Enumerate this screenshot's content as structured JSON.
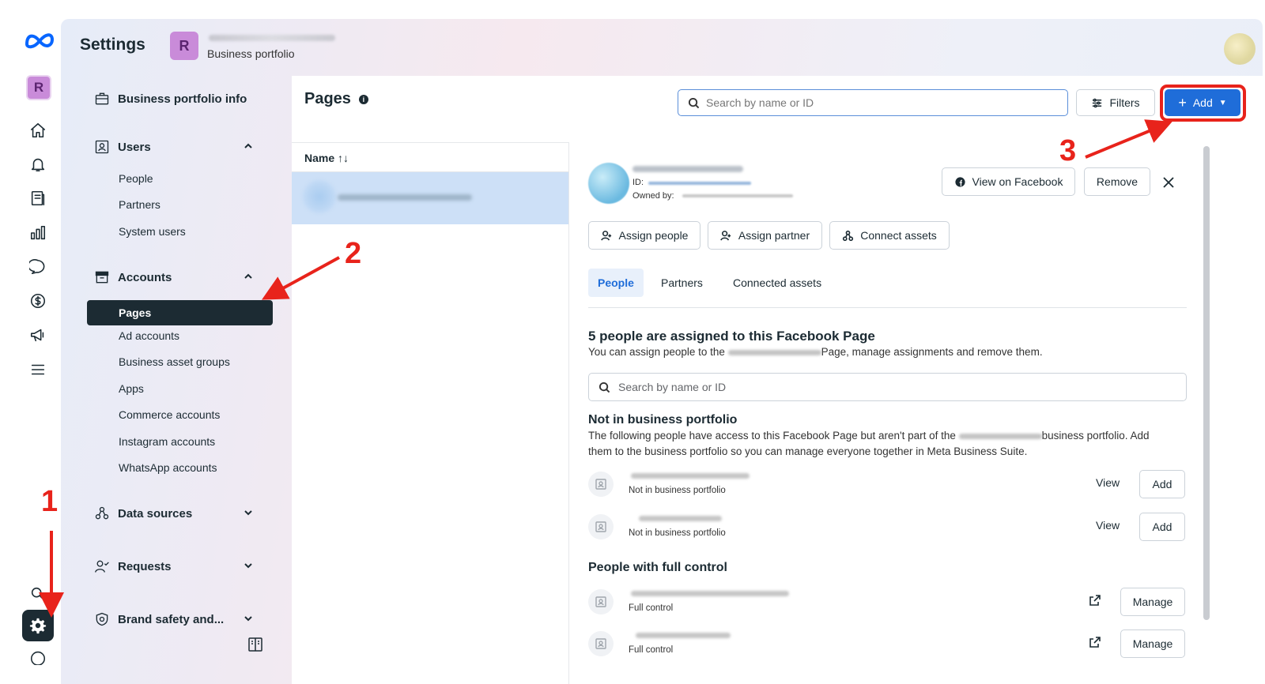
{
  "header": {
    "title": "Settings",
    "portfolio_initial": "R",
    "portfolio_subtitle": "Business portfolio"
  },
  "rail": {
    "avatar_initial": "R",
    "icons": [
      "meta-logo-icon",
      "home-icon",
      "bell-icon",
      "pages-icon",
      "chart-icon",
      "chat-icon",
      "dollar-icon",
      "megaphone-icon",
      "menu-icon",
      "search-icon",
      "gear-icon",
      "help-icon"
    ]
  },
  "sidebar": {
    "portfolio_info": "Business portfolio info",
    "users": {
      "label": "Users",
      "items": [
        "People",
        "Partners",
        "System users"
      ]
    },
    "accounts": {
      "label": "Accounts",
      "active": "Pages",
      "items": [
        "Ad accounts",
        "Business asset groups",
        "Apps",
        "Commerce accounts",
        "Instagram accounts",
        "WhatsApp accounts"
      ]
    },
    "data_sources": "Data sources",
    "requests": "Requests",
    "brand_safety": "Brand safety and..."
  },
  "main": {
    "title": "Pages",
    "search_placeholder": "Search by name or ID",
    "filters_label": "Filters",
    "add_label": "Add",
    "list_header": "Name ↑↓"
  },
  "detail": {
    "id_label": "ID:",
    "owned_label": "Owned by:",
    "view_on_facebook": "View on Facebook",
    "remove": "Remove",
    "assign_people": "Assign people",
    "assign_partner": "Assign partner",
    "connect_assets": "Connect assets",
    "tabs": [
      "People",
      "Partners",
      "Connected assets"
    ],
    "assigned_heading": "5 people are assigned to this Facebook Page",
    "assigned_text_prefix": "You can assign people to the",
    "assigned_text_suffix": "Page, manage assignments and remove them.",
    "search_placeholder": "Search by name or ID",
    "not_in_heading": "Not in business portfolio",
    "not_in_text_prefix": "The following people have access to this Facebook Page but aren't part of the",
    "not_in_text_mid": "business portfolio. Add",
    "not_in_text_line2": "them to the business portfolio so you can manage everyone together in Meta Business Suite.",
    "not_in_rows": [
      {
        "status": "Not in business portfolio",
        "view": "View",
        "action": "Add"
      },
      {
        "status": "Not in business portfolio",
        "view": "View",
        "action": "Add"
      }
    ],
    "full_heading": "People with full control",
    "full_rows": [
      {
        "status": "Full control",
        "action": "Manage"
      },
      {
        "status": "Full control",
        "action": "Manage"
      }
    ]
  },
  "annotations": [
    "1",
    "2",
    "3"
  ],
  "colors": {
    "accent": "#1f6dd9",
    "annotation": "#e8231b",
    "active_nav": "#1c2b33",
    "selected_row": "#cde0f7"
  }
}
